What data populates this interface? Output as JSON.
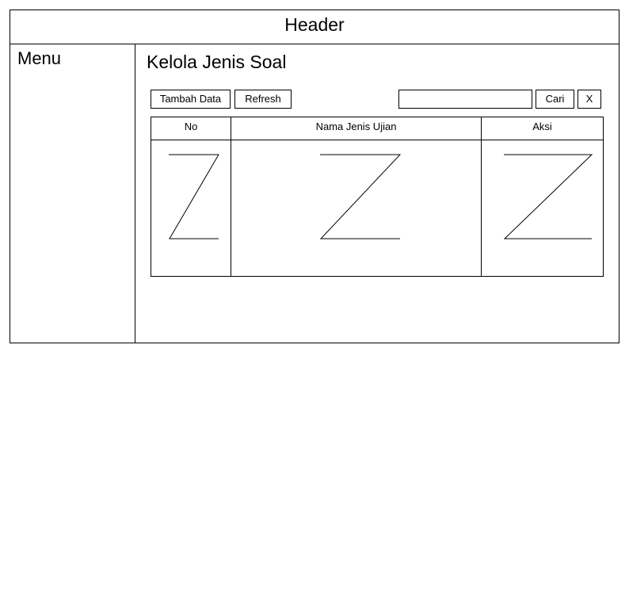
{
  "header": {
    "title": "Header"
  },
  "sidebar": {
    "menu_label": "Menu"
  },
  "main": {
    "title": "Kelola Jenis Soal",
    "toolbar": {
      "add_label": "Tambah Data",
      "refresh_label": "Refresh",
      "search_value": "",
      "search_button_label": "Cari",
      "clear_button_label": "X"
    },
    "table": {
      "columns": [
        "No",
        "Nama Jenis Ujian",
        "Aksi"
      ]
    }
  }
}
